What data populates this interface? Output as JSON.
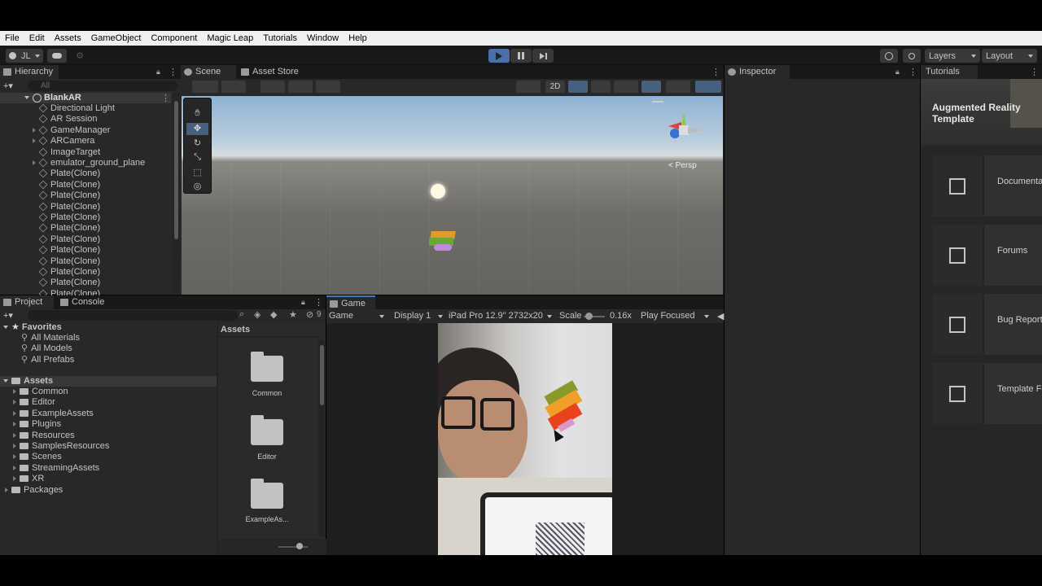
{
  "menu": [
    "File",
    "Edit",
    "Assets",
    "GameObject",
    "Component",
    "Magic Leap",
    "Tutorials",
    "Window",
    "Help"
  ],
  "toolbar": {
    "account": "JL",
    "layers": "Layers",
    "layout": "Layout"
  },
  "hierarchy": {
    "tab": "Hierarchy",
    "search_placeholder": "All",
    "scene": "BlankAR",
    "items": [
      "Directional Light",
      "AR Session",
      "GameManager",
      "ARCamera",
      "ImageTarget",
      "emulator_ground_plane",
      "Plate(Clone)",
      "Plate(Clone)",
      "Plate(Clone)",
      "Plate(Clone)",
      "Plate(Clone)",
      "Plate(Clone)",
      "Plate(Clone)",
      "Plate(Clone)",
      "Plate(Clone)",
      "Plate(Clone)",
      "Plate(Clone)",
      "Plate(Clone)"
    ]
  },
  "scene": {
    "tabs": [
      "Scene",
      "Asset Store"
    ],
    "persp": "< Persp",
    "btn_2d": "2D"
  },
  "inspector": {
    "tab": "Inspector"
  },
  "tutorials": {
    "tab": "Tutorials",
    "header": "Augmented Reality Template",
    "cards": [
      "Documenta",
      "Forums",
      "Bug Reporti",
      "Template Fe"
    ]
  },
  "project": {
    "tabs": [
      "Project",
      "Console"
    ],
    "hidden_count": "9",
    "favorites_label": "Favorites",
    "favorites": [
      "All Materials",
      "All Models",
      "All Prefabs"
    ],
    "assets_label": "Assets",
    "asset_folders": [
      "Common",
      "Editor",
      "ExampleAssets",
      "Plugins",
      "Resources",
      "SamplesResources",
      "Scenes",
      "StreamingAssets",
      "XR"
    ],
    "packages_label": "Packages",
    "grid_title": "Assets",
    "grid_items": [
      "Common",
      "Editor",
      "ExampleAs..."
    ]
  },
  "game": {
    "tab": "Game",
    "mode": "Game",
    "display": "Display 1",
    "device": "iPad Pro 12.9\" 2732x20",
    "scale_label": "Scale",
    "scale_value": "0.16x",
    "play_mode": "Play Focused"
  }
}
